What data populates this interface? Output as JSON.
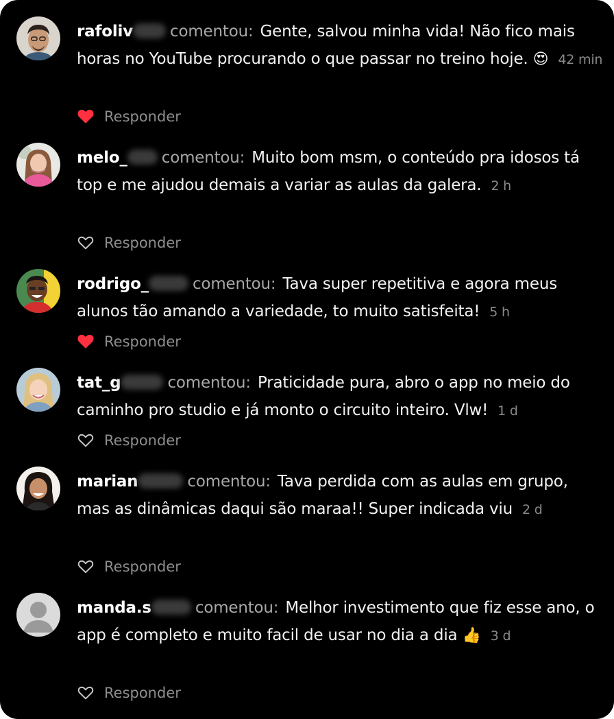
{
  "comments": [
    {
      "user": "rafoliv",
      "verb": "comentou:",
      "text": "Gente, salvou minha vida! Não fico mais horas no YouTube procurando o que passar no treino hoje.",
      "emoji": "😍",
      "time": "42 min",
      "liked": true,
      "reply": "Responder"
    },
    {
      "user": "melo_",
      "verb": "comentou:",
      "text": "Muito bom msm, o conteúdo pra idosos tá top e me ajudou demais a variar as aulas da galera.",
      "emoji": "",
      "time": "2 h",
      "liked": false,
      "reply": "Responder"
    },
    {
      "user": "rodrigo_",
      "verb": "comentou:",
      "text": "Tava super repetitiva e agora meus alunos tão amando a variedade, to muito satisfeita!",
      "emoji": "",
      "time": "5 h",
      "liked": true,
      "reply": "Responder"
    },
    {
      "user": "tat_g",
      "verb": "comentou:",
      "text": "Praticidade pura, abro o app no meio do caminho pro studio e já monto o circuito inteiro. Vlw!",
      "emoji": "",
      "time": "1 d",
      "liked": false,
      "reply": "Responder"
    },
    {
      "user": "marian",
      "verb": "comentou:",
      "text": "Tava perdida com as aulas em grupo, mas as dinâmicas daqui são maraa!! Super indicada viu",
      "emoji": "",
      "time": "2 d",
      "liked": false,
      "reply": "Responder"
    },
    {
      "user": "manda.s",
      "verb": "comentou:",
      "text": "Melhor investimento que fiz esse ano, o app é completo e muito facil de usar no dia a dia",
      "emoji": "👍",
      "time": "3 d",
      "liked": false,
      "reply": "Responder"
    }
  ],
  "colors": {
    "background": "#000000",
    "liked_heart": "#ff3040",
    "muted_text": "#8e8e8e"
  }
}
